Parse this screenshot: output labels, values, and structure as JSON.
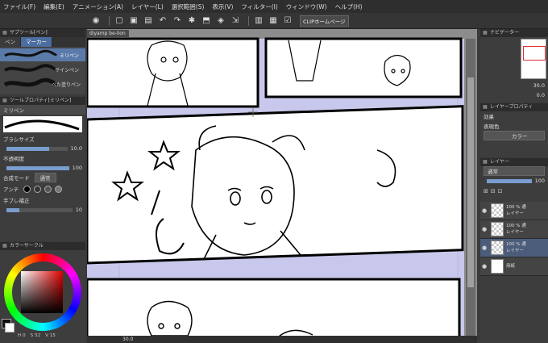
{
  "menubar": {
    "items": [
      "ファイル(F)",
      "編集(E)",
      "アニメーション(A)",
      "レイヤー(L)",
      "選択範囲(S)",
      "表示(V)",
      "フィルター(I)",
      "ウィンドウ(W)",
      "ヘルプ(H)"
    ]
  },
  "toolbar": {
    "clip_button": "CLIPホームページ"
  },
  "subtool_panel": {
    "title": "サブツール[ペン]",
    "tabs": [
      "ペン",
      "マーカー"
    ],
    "brushes": [
      "ミリペン",
      "サインペン",
      "べた塗りペン"
    ]
  },
  "tool_property": {
    "title": "ツールプロパティ[ミリペン]",
    "tool_name": "ミリペン",
    "brush_size_label": "ブラシサイズ",
    "brush_size_value": "10.0",
    "opacity_label": "不透明度",
    "opacity_value": "100",
    "blend_label": "合成モード",
    "blend_value": "通常",
    "aa_label": "アンチ",
    "stab_label": "手ブレ補正",
    "stab_value": "10"
  },
  "color_panel": {
    "title": "カラーサークル",
    "h_value": "0",
    "s_value": "52",
    "v_value": "15"
  },
  "document": {
    "tab_label": "diyamp be-lion"
  },
  "status": {
    "zoom": "30.0"
  },
  "navigator": {
    "title": "ナビゲーター",
    "zoom": "30.0",
    "angle": "0.0"
  },
  "layer_property": {
    "title": "レイヤープロパティ",
    "effect_label": "効果",
    "color_label": "表現色",
    "color_value": "カラー"
  },
  "layer_panel": {
    "title": "レイヤー",
    "blend": "通常",
    "opacity": "100",
    "layers": [
      {
        "line1": "100 % 通",
        "line2": "レイヤー"
      },
      {
        "line1": "100 % 通",
        "line2": "レイヤー"
      },
      {
        "line1": "100 % 通",
        "line2": "レイヤー"
      },
      {
        "line1": "",
        "line2": "用紙"
      }
    ]
  },
  "colors": {
    "panel_bg": "#3d3d3d",
    "accent": "#4b6da0",
    "frame_bg": "#c8c8ec"
  }
}
